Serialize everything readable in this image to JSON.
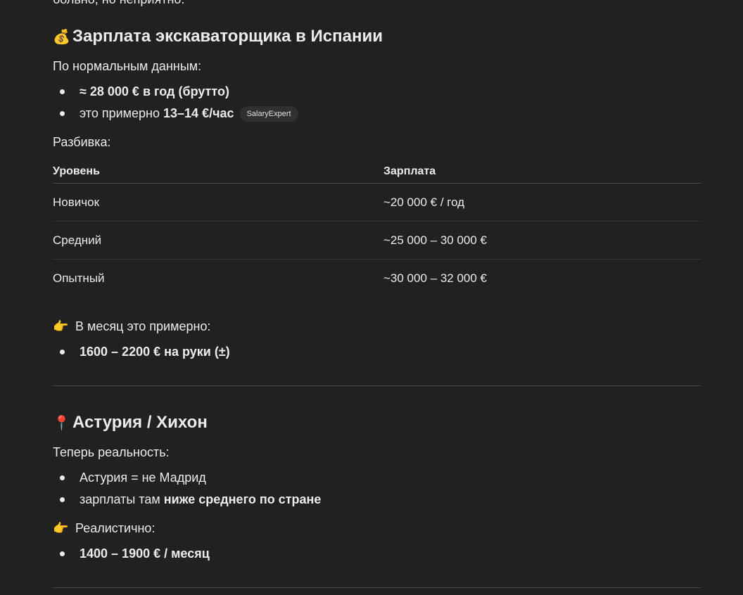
{
  "intro_cutoff": "больно, но неприятно.",
  "section1": {
    "icon": "money-bag-icon",
    "title": "Зарплата экскаваторщика в Испании",
    "lead": "По нормальным данным:",
    "bullets": [
      {
        "bold": "≈ 28 000 € в год (брутто)"
      },
      {
        "text": "это примерно ",
        "bold": "13–14 €/час",
        "source": "SalaryExpert"
      }
    ],
    "breakdown_label": "Разбивка:",
    "table": {
      "headers": [
        "Уровень",
        "Зарплата"
      ],
      "rows": [
        [
          "Новичок",
          "~20 000 € / год"
        ],
        [
          "Средний",
          "~25 000 – 30 000 €"
        ],
        [
          "Опытный",
          "~30 000 – 32 000 €"
        ]
      ]
    },
    "monthly_icon": "pointing-hand-icon",
    "monthly_label": "В месяц это примерно:",
    "monthly_bullet": "1600 – 2200 € на руки (±)"
  },
  "section2": {
    "icon": "pushpin-icon",
    "title": "Астурия / Хихон",
    "lead": "Теперь реальность:",
    "bullets": [
      {
        "text": "Астурия = не Мадрид"
      },
      {
        "text": "зарплаты там ",
        "bold": "ниже среднего по стране"
      }
    ],
    "realistic_icon": "pointing-hand-icon",
    "realistic_label": "Реалистично:",
    "realistic_bullet": "1400 – 1900 € / месяц"
  },
  "colors": {
    "background": "#212121",
    "text": "#ececec",
    "pill_bg": "#303030",
    "divider": "#464646"
  }
}
